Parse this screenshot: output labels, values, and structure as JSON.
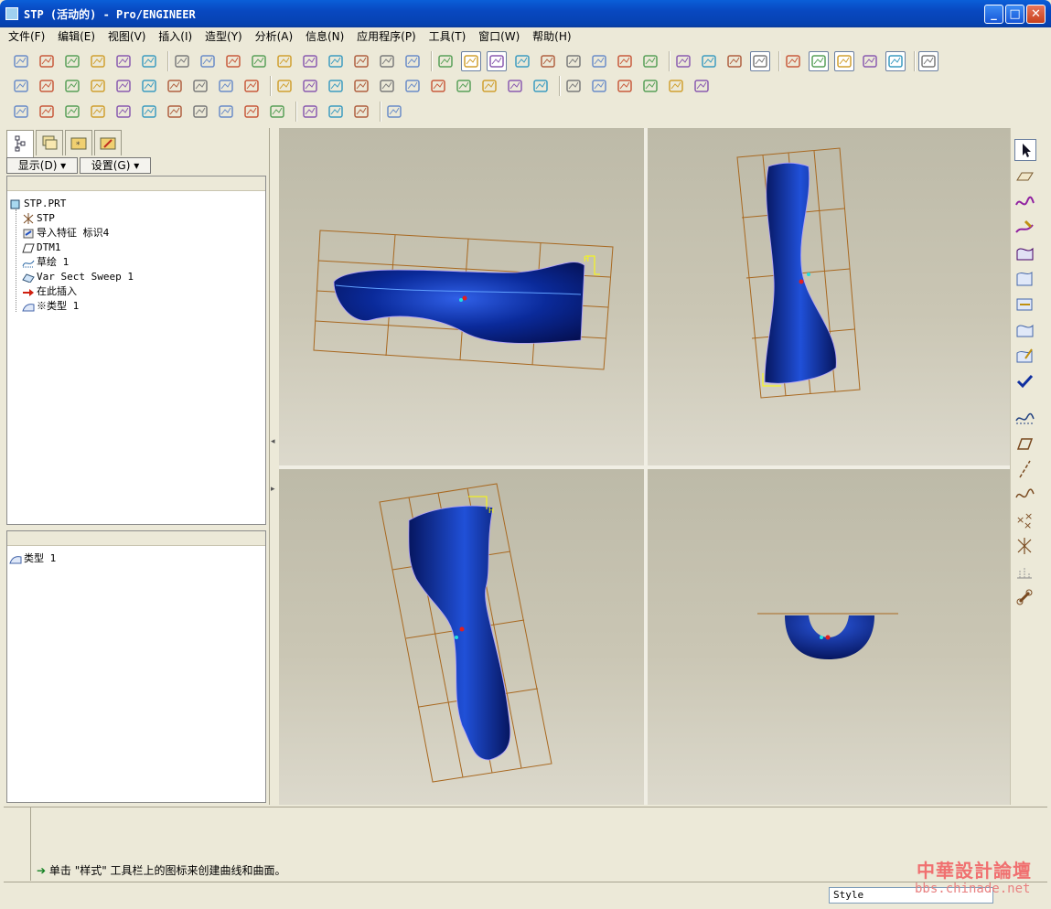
{
  "window": {
    "title": "STP (活动的) - Pro/ENGINEER",
    "minimize": "_",
    "maximize": "□",
    "close": "✕"
  },
  "menu": [
    "文件(F)",
    "编辑(E)",
    "视图(V)",
    "插入(I)",
    "造型(Y)",
    "分析(A)",
    "信息(N)",
    "应用程序(P)",
    "工具(T)",
    "窗口(W)",
    "帮助(H)"
  ],
  "panel": {
    "show_label": "显示(D) ▾",
    "settings_label": "设置(G) ▾"
  },
  "tree": [
    {
      "label": "STP.PRT",
      "icon": "part-icon"
    },
    {
      "label": "STP",
      "icon": "csys-icon"
    },
    {
      "label": "导入特征 标识4",
      "icon": "import-feature-icon"
    },
    {
      "label": "DTM1",
      "icon": "datum-plane-icon"
    },
    {
      "label": "草绘 1",
      "icon": "sketch-icon"
    },
    {
      "label": "Var Sect Sweep 1",
      "icon": "sweep-icon"
    },
    {
      "label": "在此插入",
      "icon": "insert-arrow-icon"
    },
    {
      "label": "※类型 1",
      "icon": "style-feature-icon"
    }
  ],
  "lower_panel": {
    "item": "类型 1"
  },
  "message": "单击 \"样式\" 工具栏上的图标来创建曲线和曲面。",
  "status": {
    "style_value": "Style"
  },
  "watermark": {
    "line1": "中華設計論壇",
    "line2": "bbs.chinade.net"
  },
  "colors": {
    "surface_blue": "#0a2a9a",
    "grid_orange": "#a86820",
    "titlebar_blue": "#0a5fd8"
  }
}
